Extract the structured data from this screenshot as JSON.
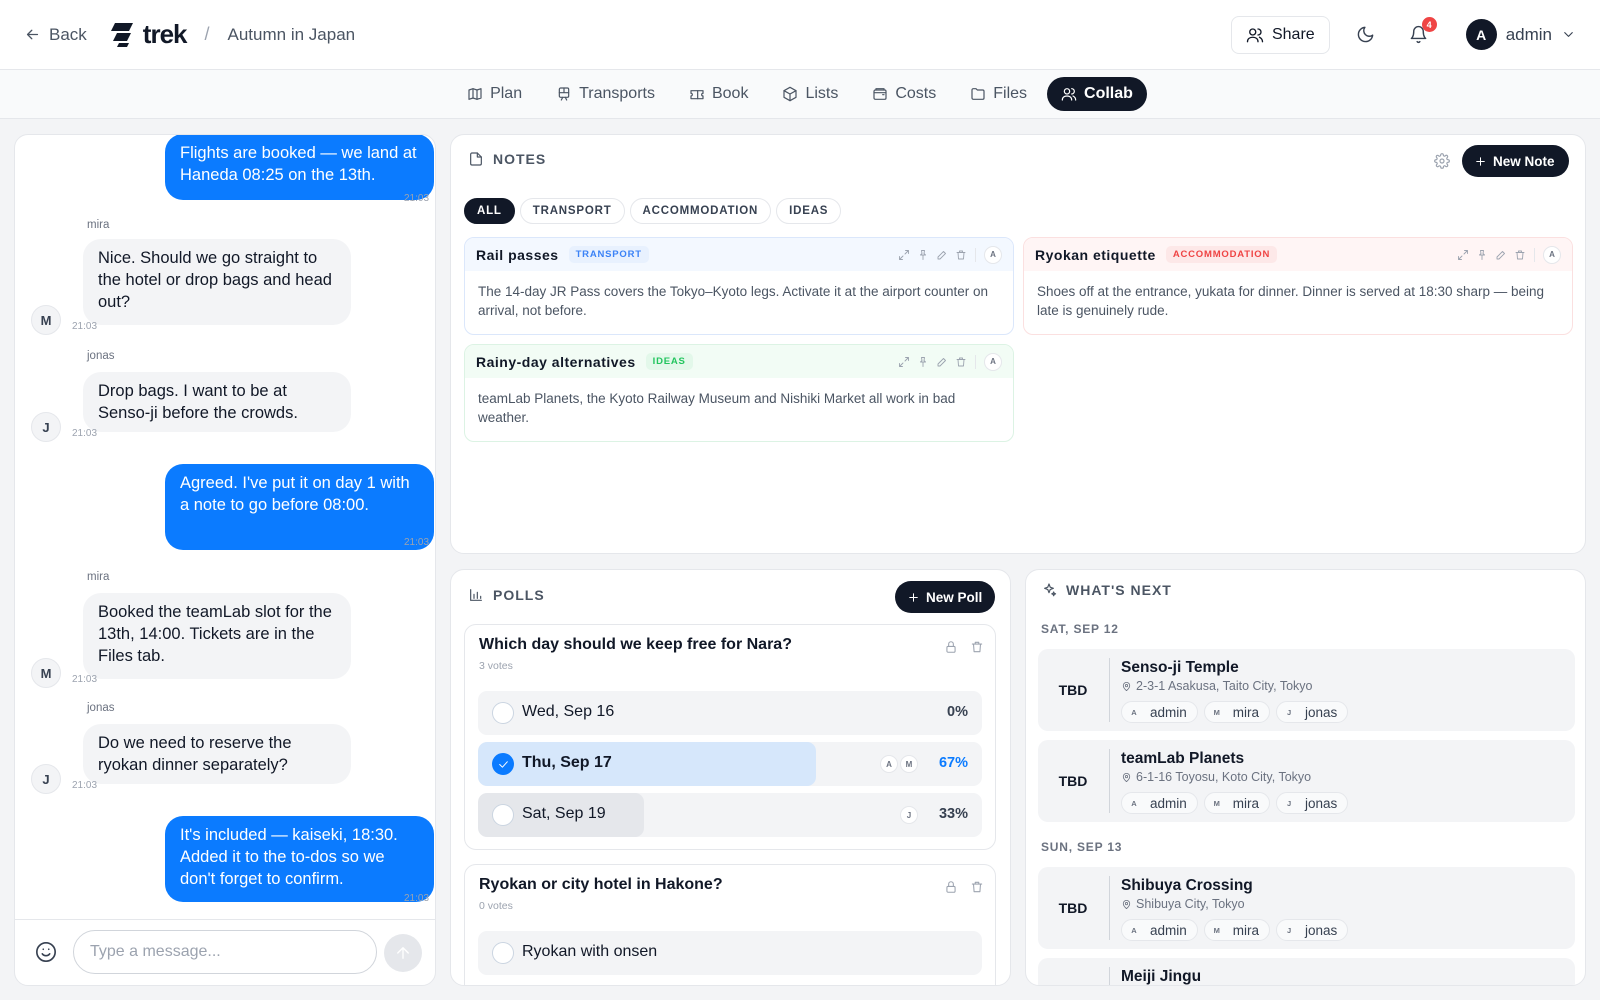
{
  "header": {
    "back_label": "Back",
    "logo_text": "trek",
    "crumb_separator": "/",
    "trip_name": "Autumn in Japan",
    "share_label": "Share",
    "notification_count": "4",
    "user_initial": "A",
    "user_name": "admin"
  },
  "tabs": [
    {
      "label": "Plan",
      "icon": "map-icon"
    },
    {
      "label": "Transports",
      "icon": "train-icon"
    },
    {
      "label": "Book",
      "icon": "ticket-icon"
    },
    {
      "label": "Lists",
      "icon": "package-icon"
    },
    {
      "label": "Costs",
      "icon": "wallet-icon"
    },
    {
      "label": "Files",
      "icon": "folder-icon"
    },
    {
      "label": "Collab",
      "icon": "users-icon",
      "active": true
    }
  ],
  "chat": {
    "messages": [
      {
        "mine": true,
        "text": "Flights are booked — we land at Haneda 08:25 on the 13th.",
        "time": "21:03"
      },
      {
        "mine": false,
        "author": "mira",
        "initial": "M",
        "text": "Nice. Should we go straight to the hotel or drop bags and head out?",
        "time": "21:03"
      },
      {
        "mine": false,
        "author": "jonas",
        "initial": "J",
        "text": "Drop bags. I want to be at Senso-ji before the crowds.",
        "time": "21:03"
      },
      {
        "mine": true,
        "text": "Agreed. I've put it on day 1 with a note to go before 08:00.",
        "time": "21:03"
      },
      {
        "mine": false,
        "author": "mira",
        "initial": "M",
        "text": "Booked the teamLab slot for the 13th, 14:00. Tickets are in the Files tab.",
        "time": "21:03"
      },
      {
        "mine": false,
        "author": "jonas",
        "initial": "J",
        "text": "Do we need to reserve the ryokan dinner separately?",
        "time": "21:03"
      },
      {
        "mine": true,
        "text": "It's included — kaiseki, 18:30. Added it to the to-dos so we don't forget to confirm.",
        "time": "21:03"
      }
    ],
    "input_placeholder": "Type a message..."
  },
  "notes": {
    "title": "NOTES",
    "new_note_label": "New Note",
    "filters": [
      "ALL",
      "TRANSPORT",
      "ACCOMMODATION",
      "IDEAS"
    ],
    "active_filter": "ALL",
    "items": [
      {
        "title": "Rail passes",
        "tag": "TRANSPORT",
        "tag_color": "#3b82f6",
        "tag_bg": "#e8f1fe",
        "head_bg": "#f3f8ff",
        "border": "#dbe7fb",
        "author": "A",
        "body": "The 14-day JR Pass covers the Tokyo–Kyoto legs. Activate it at the airport counter on arrival, not before."
      },
      {
        "title": "Ryokan etiquette",
        "tag": "ACCOMMODATION",
        "tag_color": "#ef4444",
        "tag_bg": "#fde8e8",
        "head_bg": "#fff5f5",
        "border": "#fbe0e0",
        "author": "A",
        "body": "Shoes off at the entrance, yukata for dinner. Dinner is served at 18:30 sharp — being late is genuinely rude."
      },
      {
        "title": "Rainy-day alternatives",
        "tag": "IDEAS",
        "tag_color": "#22c55e",
        "tag_bg": "#e3f8ea",
        "head_bg": "#f2fcf5",
        "border": "#dcf3e4",
        "author": "A",
        "body": "teamLab Planets, the Kyoto Railway Museum and Nishiki Market all work in bad weather."
      }
    ]
  },
  "polls": {
    "title": "POLLS",
    "new_poll_label": "New Poll",
    "items": [
      {
        "question": "Which day should we keep free for Nara?",
        "votes": "3 votes",
        "options": [
          {
            "label": "Wed, Sep 16",
            "percent": "0%",
            "fraction": 0,
            "selected": false,
            "voters": []
          },
          {
            "label": "Thu, Sep 17",
            "percent": "67%",
            "fraction": 0.67,
            "selected": true,
            "voters": [
              "A",
              "M"
            ]
          },
          {
            "label": "Sat, Sep 19",
            "percent": "33%",
            "fraction": 0.33,
            "selected": false,
            "voters": [
              "J"
            ]
          }
        ]
      },
      {
        "question": "Ryokan or city hotel in Hakone?",
        "votes": "0 votes",
        "options": [
          {
            "label": "Ryokan with onsen",
            "percent": "",
            "fraction": 0,
            "selected": false,
            "voters": []
          }
        ]
      }
    ]
  },
  "whats_next": {
    "title": "WHAT'S NEXT",
    "days": [
      {
        "label": "SAT, SEP 12",
        "events": [
          {
            "time": "TBD",
            "name": "Senso-ji Temple",
            "location": "2-3-1 Asakusa, Taito City, Tokyo",
            "people": [
              {
                "initial": "A",
                "name": "admin"
              },
              {
                "initial": "M",
                "name": "mira"
              },
              {
                "initial": "J",
                "name": "jonas"
              }
            ]
          },
          {
            "time": "TBD",
            "name": "teamLab Planets",
            "location": "6-1-16 Toyosu, Koto City, Tokyo",
            "people": [
              {
                "initial": "A",
                "name": "admin"
              },
              {
                "initial": "M",
                "name": "mira"
              },
              {
                "initial": "J",
                "name": "jonas"
              }
            ]
          }
        ]
      },
      {
        "label": "SUN, SEP 13",
        "events": [
          {
            "time": "TBD",
            "name": "Shibuya Crossing",
            "location": "Shibuya City, Tokyo",
            "people": [
              {
                "initial": "A",
                "name": "admin"
              },
              {
                "initial": "M",
                "name": "mira"
              },
              {
                "initial": "J",
                "name": "jonas"
              }
            ]
          },
          {
            "time": "",
            "name": "Meiji Jingu",
            "location": "",
            "people": []
          }
        ]
      }
    ]
  },
  "colors": {
    "accent_blue": "#0b7bff",
    "dark": "#111827",
    "badge_red": "#ef4444"
  }
}
